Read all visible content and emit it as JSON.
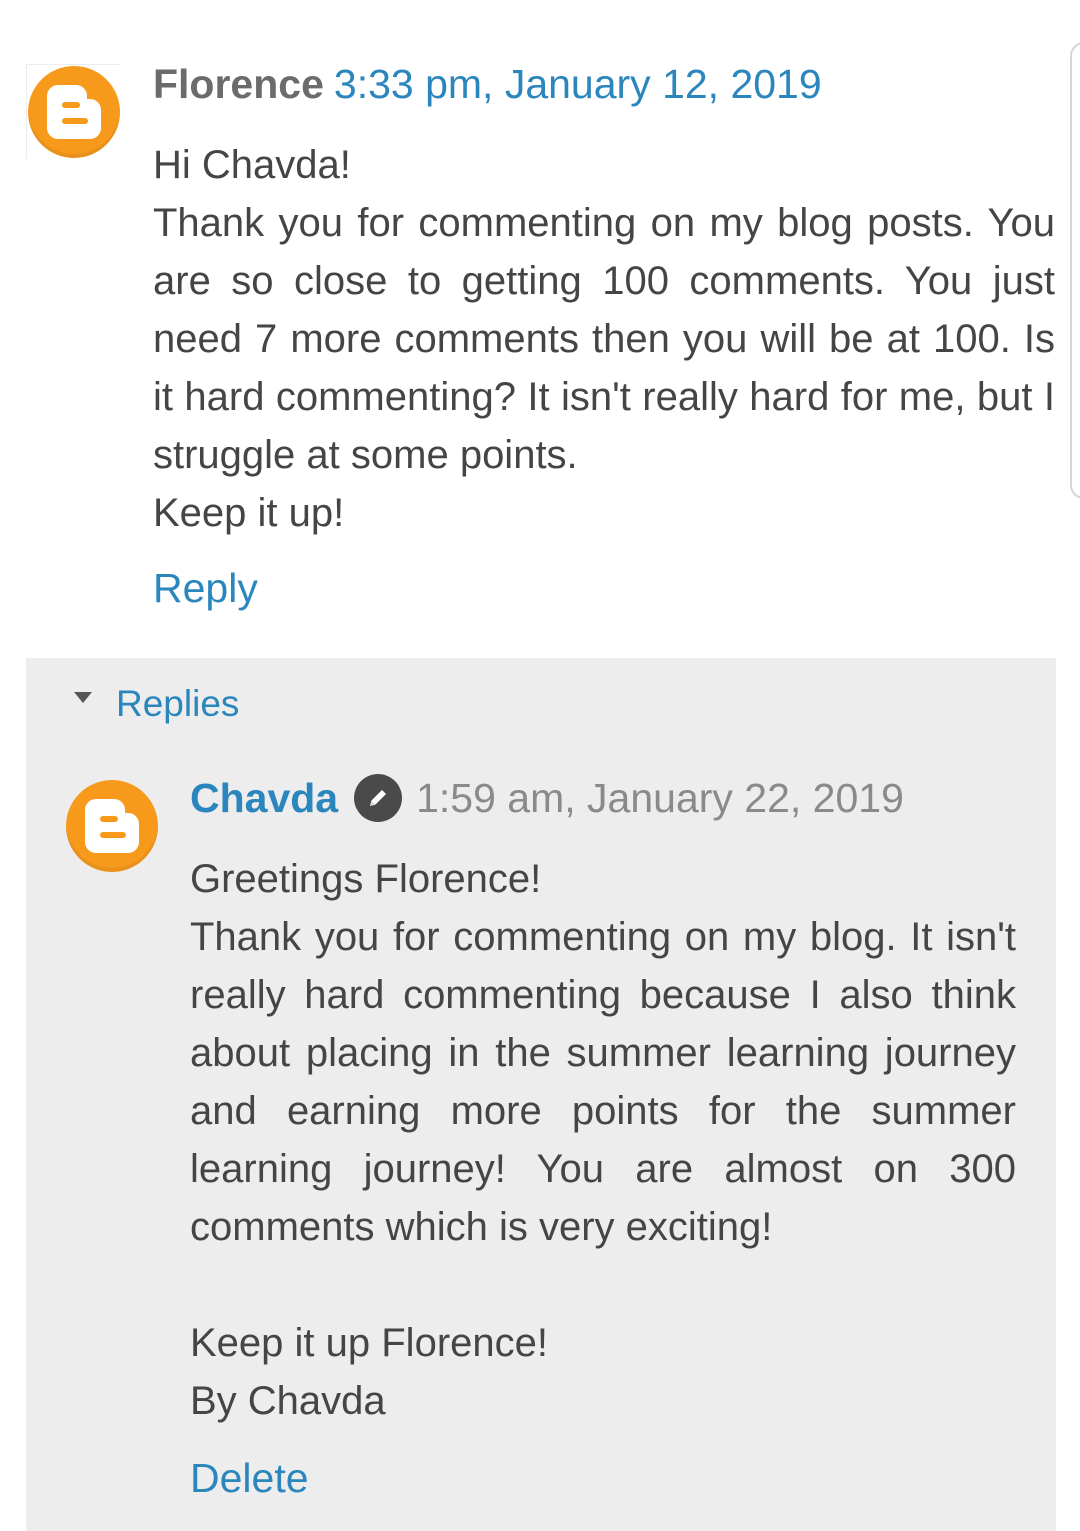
{
  "colors": {
    "link": "#2a86bd",
    "author": "#6b6b6b",
    "body_text": "#454545",
    "replies_background": "#ededed",
    "blogger_orange": "#f79a1c"
  },
  "comment": {
    "author": "Florence",
    "timestamp": "3:33 pm, January 12, 2019",
    "avatar_icon": "blogger-logo-icon",
    "body": [
      "Hi Chavda!",
      "Thank you for commenting on my blog posts. You are so close to getting 100 comments. You just need 7 more comments then you will be at 100. Is it hard commenting? It isn't really hard for me, but I struggle at some points.",
      "Keep it up!"
    ],
    "reply_label": "Reply"
  },
  "replies": {
    "toggle_label": "Replies",
    "toggle_icon": "caret-down-icon",
    "items": [
      {
        "author": "Chavda",
        "author_badge_icon": "pencil-icon",
        "timestamp": "1:59 am, January 22, 2019",
        "avatar_icon": "blogger-logo-icon",
        "body": [
          "Greetings Florence!",
          "Thank you for commenting on my blog. It isn't really hard commenting because I also think about placing in the summer learning journey and earning more points for the summer learning journey! You are almost on 300 comments which is very exciting!",
          "",
          "Keep it up Florence!",
          "By Chavda"
        ],
        "delete_label": "Delete"
      }
    ]
  }
}
